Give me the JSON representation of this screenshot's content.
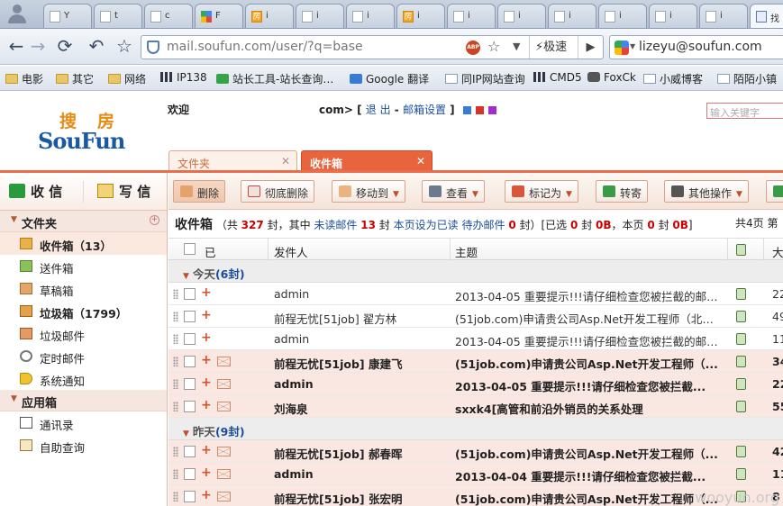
{
  "browser": {
    "tabs": [
      {
        "label": "Y",
        "favicon": "page"
      },
      {
        "label": "t",
        "favicon": "page"
      },
      {
        "label": "c",
        "favicon": "page"
      },
      {
        "label": "F",
        "favicon": "google"
      },
      {
        "label": "i",
        "favicon": "fang"
      },
      {
        "label": "i",
        "favicon": "page"
      },
      {
        "label": "i",
        "favicon": "page"
      },
      {
        "label": "i",
        "favicon": "fang"
      },
      {
        "label": "i",
        "favicon": "page"
      },
      {
        "label": "i",
        "favicon": "page"
      },
      {
        "label": "i",
        "favicon": "page"
      },
      {
        "label": "i",
        "favicon": "page"
      },
      {
        "label": "i",
        "favicon": "page"
      },
      {
        "label": "i",
        "favicon": "page"
      },
      {
        "label": "找",
        "favicon": "mail",
        "active": true
      }
    ],
    "address": "mail.soufun.com/user/?q=base",
    "speed_label": "极速",
    "search_value": "lizeyu@soufun.com",
    "bookmarks": [
      {
        "label": "电影",
        "icon": "folder"
      },
      {
        "label": "其它",
        "icon": "folder"
      },
      {
        "label": "网络",
        "icon": "folder"
      },
      {
        "label": "IP138",
        "icon": "grid"
      },
      {
        "label": "站长工具-站长查询…",
        "icon": "green"
      },
      {
        "label": "Google 翻译",
        "icon": "blue"
      },
      {
        "label": "同IP网站查询",
        "icon": "page"
      },
      {
        "label": "CMD5",
        "icon": "grid"
      },
      {
        "label": "FoxCk",
        "icon": "fox"
      },
      {
        "label": "小威博客",
        "icon": "page"
      },
      {
        "label": "陌陌小镇",
        "icon": "page"
      }
    ]
  },
  "header": {
    "logo_cn_1": "搜",
    "logo_cn_2": "房",
    "logo_en": "SouFun",
    "welcome": "欢迎",
    "address_tail": "com>",
    "logout": "退 出",
    "settings": "邮箱设置",
    "search_placeholder": "输入关键字",
    "skin_colors": [
      "#3a7bd5",
      "#d8322a",
      "#a22cd0"
    ]
  },
  "tabs": {
    "folder": "文件夹",
    "inbox": "收件箱"
  },
  "sidebar": {
    "receive": "收 信",
    "compose": "写 信",
    "folders_title": "文件夹",
    "folders": [
      {
        "label": "收件箱（13）",
        "icon": "inbox-icon",
        "selected": true
      },
      {
        "label": "送件箱",
        "icon": "sent-icon"
      },
      {
        "label": "草稿箱",
        "icon": "drafts-icon"
      },
      {
        "label": "垃圾箱（1799）",
        "icon": "trash-icon",
        "bold": true
      },
      {
        "label": "垃圾邮件",
        "icon": "spam-icon"
      },
      {
        "label": "定时邮件",
        "icon": "clock-icon"
      },
      {
        "label": "系统通知",
        "icon": "speaker-icon"
      }
    ],
    "apps_title": "应用箱",
    "apps": [
      {
        "label": "通讯录",
        "icon": "contacts-icon"
      },
      {
        "label": "自助查询",
        "icon": "query-icon"
      }
    ]
  },
  "toolbar": {
    "delete": "删除",
    "purge": "彻底删除",
    "move": "移动到",
    "view": "查看",
    "mark": "标记为",
    "forward": "转寄",
    "more": "其他操作"
  },
  "status": {
    "title": "收件箱",
    "total_pre": "（共",
    "total": "327",
    "total_mid": "封，其中",
    "unread_label": "未读邮件",
    "unread": "13",
    "unread_post": "封",
    "mark_read": "本页设为已读",
    "pending_label": "待办邮件",
    "pending": "0",
    "pending_post": "封）[已选",
    "selected": "0",
    "sel_mid": "封",
    "sel_size": "0B",
    "page_mid": "，本页",
    "page_count": "0",
    "page_mid2": "封",
    "page_size": "0B",
    "close": "]",
    "pages": "共4页 第"
  },
  "columns": {
    "read_state": "已",
    "sender": "发件人",
    "subject": "主题",
    "size": "大"
  },
  "groups": {
    "today": "今天",
    "today_count": "(6封)",
    "yesterday": "昨天",
    "yesterday_count": "(9封)"
  },
  "today_rows": [
    {
      "from": "admin",
      "subject": "2013-04-05 重要提示!!!请仔细检查您被拦截的邮件...",
      "size": "22",
      "unread": false
    },
    {
      "from": "前程无忧[51job] 翟方林",
      "subject": "(51job.com)申请贵公司Asp.Net开发工程师（北京...",
      "size": "49",
      "unread": false
    },
    {
      "from": "admin",
      "subject": "2013-04-05 重要提示!!!请仔细检查您被拦截的邮件...",
      "size": "11",
      "unread": false
    },
    {
      "from": "前程无忧[51job] 康建飞",
      "subject": "(51job.com)申请贵公司Asp.Net开发工程师（...",
      "size": "34",
      "unread": true
    },
    {
      "from": "admin",
      "subject": "2013-04-05 重要提示!!!请仔细检查您被拦截...",
      "size": "22",
      "unread": true
    },
    {
      "from": "刘海泉",
      "subject": "sxxk4[高管和前沿外销员的关系处理",
      "size": "55",
      "unread": true
    }
  ],
  "yesterday_rows": [
    {
      "from": "前程无忧[51job] 郝春晖",
      "subject": "(51job.com)申请贵公司Asp.Net开发工程师（...",
      "size": "42",
      "unread": true
    },
    {
      "from": "admin",
      "subject": "2013-04-04 重要提示!!!请仔细检查您被拦截...",
      "size": "11",
      "unread": true
    },
    {
      "from": "前程无忧[51job] 张宏明",
      "subject": "(51job.com)申请贵公司Asp.Net开发工程师（...",
      "size": "8",
      "unread": true
    }
  ],
  "watermark": "wooyun.org"
}
